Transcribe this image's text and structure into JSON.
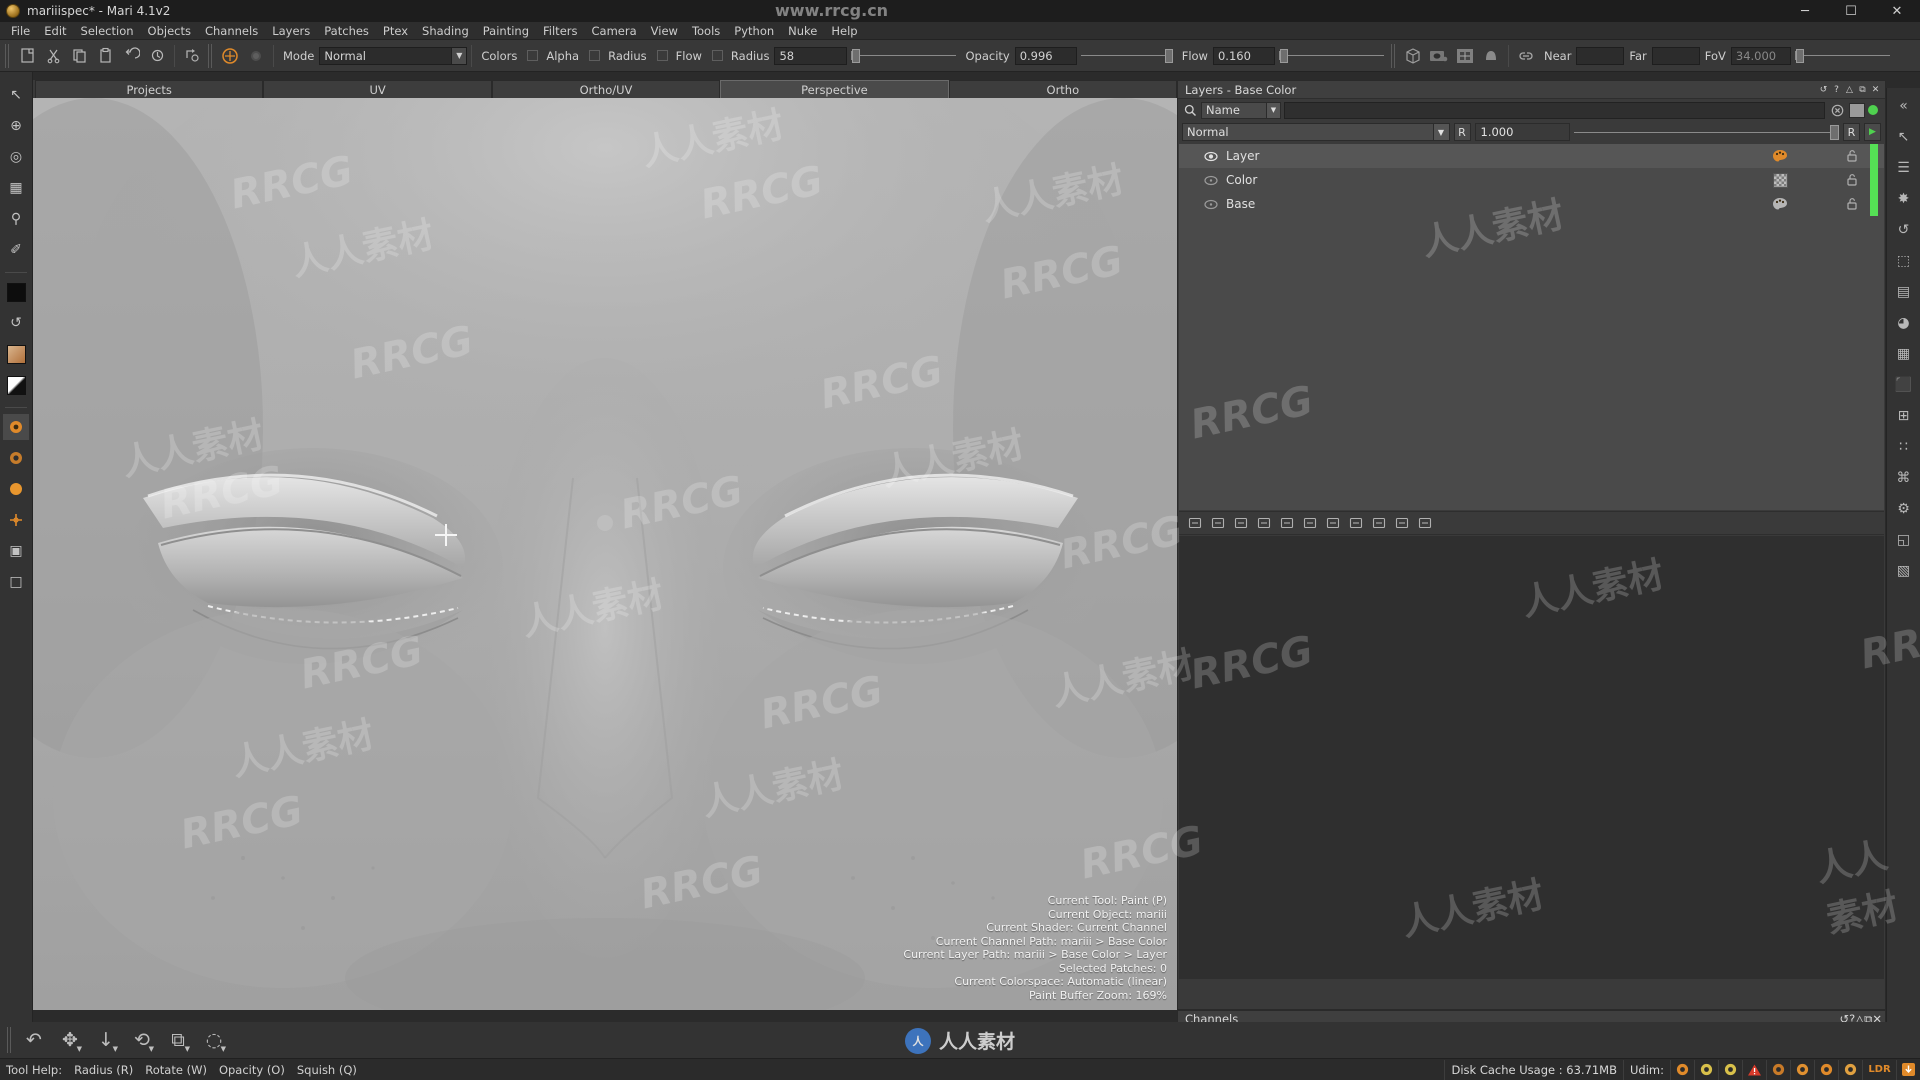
{
  "window": {
    "title": "mariiispec* - Mari 4.1v2",
    "app_icon": "mari-logo-icon",
    "controls": {
      "minimize": "─",
      "maximize": "☐",
      "close": "✕"
    }
  },
  "menubar": {
    "items": [
      "File",
      "Edit",
      "Selection",
      "Objects",
      "Channels",
      "Layers",
      "Patches",
      "Ptex",
      "Shading",
      "Painting",
      "Filters",
      "Camera",
      "View",
      "Tools",
      "Python",
      "Nuke",
      "Help"
    ]
  },
  "toolbar": {
    "mode_label": "Mode",
    "mode_value": "Normal",
    "colors_label": "Colors",
    "alpha_label": "Alpha",
    "radius_check_label": "Radius",
    "flow_check_label": "Flow",
    "radius_label": "Radius",
    "radius_value": "58",
    "opacity_label": "Opacity",
    "opacity_value": "0.996",
    "flow_label": "Flow",
    "flow_value": "0.160",
    "near_label": "Near",
    "near_value": "",
    "far_label": "Far",
    "far_value": "",
    "fov_label": "FoV",
    "fov_value": "34.000",
    "icons": [
      "new-project-icon",
      "cut-icon",
      "copy-icon",
      "paste-icon",
      "undo-history-icon",
      "redo-history-icon",
      "transform-icon",
      "paint-target-icon",
      "blur-brush-icon",
      "cube-view-icon",
      "camera-view-icon",
      "uv-grid-icon",
      "shader-ball-icon",
      "link-camera-icon"
    ]
  },
  "left_tools": {
    "items": [
      {
        "name": "select-arrow-tool",
        "glyph": "↖"
      },
      {
        "name": "paint-target-tool",
        "glyph": "⊕"
      },
      {
        "name": "magnifier-select-tool",
        "glyph": "◎"
      },
      {
        "name": "grid-marquee-tool",
        "glyph": "▦"
      },
      {
        "name": "zoom-tool",
        "glyph": "⚲"
      },
      {
        "name": "eyedropper-tool",
        "glyph": "✐"
      },
      {
        "name": "foreground-color-swatch",
        "glyph": ""
      },
      {
        "name": "swap-colors-tool",
        "glyph": "↺"
      },
      {
        "name": "gradient-swatch",
        "glyph": ""
      },
      {
        "name": "gradient-ramp-swatch",
        "glyph": ""
      },
      {
        "name": "paint-brush-tool",
        "glyph": "✎"
      },
      {
        "name": "blur-tool",
        "glyph": "◉"
      },
      {
        "name": "smudge-tool",
        "glyph": "⬤"
      },
      {
        "name": "clone-stamp-tool",
        "glyph": "✛"
      },
      {
        "name": "transform-selection-tool",
        "glyph": "▣"
      },
      {
        "name": "crop-tool",
        "glyph": "□"
      }
    ]
  },
  "right_rail": {
    "items": [
      {
        "name": "collapse-panel-icon",
        "glyph": "«"
      },
      {
        "name": "pin-panel-icon",
        "glyph": "↖"
      },
      {
        "name": "layers-palette-icon",
        "glyph": "☰"
      },
      {
        "name": "shading-palette-icon",
        "glyph": "✸"
      },
      {
        "name": "history-palette-icon",
        "glyph": "↺"
      },
      {
        "name": "projectors-palette-icon",
        "glyph": "⬚"
      },
      {
        "name": "image-manager-icon",
        "glyph": "▤"
      },
      {
        "name": "color-palette-icon",
        "glyph": "◕"
      },
      {
        "name": "shelf-palette-icon",
        "glyph": "▦"
      },
      {
        "name": "objects-palette-icon",
        "glyph": "⬛"
      },
      {
        "name": "uv-palette-icon",
        "glyph": "⊞"
      },
      {
        "name": "patches-palette-icon",
        "glyph": "∷"
      },
      {
        "name": "python-palette-icon",
        "glyph": "⌘"
      },
      {
        "name": "tool-properties-icon",
        "glyph": "⚙"
      },
      {
        "name": "snapshots-palette-icon",
        "glyph": "◱"
      },
      {
        "name": "channels-palette-icon",
        "glyph": "▧"
      }
    ]
  },
  "tabs": {
    "items": [
      {
        "label": "Projects",
        "active": false
      },
      {
        "label": "UV",
        "active": false
      },
      {
        "label": "Ortho/UV",
        "active": false
      },
      {
        "label": "Perspective",
        "active": true
      },
      {
        "label": "Ortho",
        "active": false
      }
    ]
  },
  "viewport": {
    "status_lines": [
      "Current Tool: Paint (P)",
      "Current Object: mariii",
      "Current Shader: Current Channel",
      "Current Channel Path: mariii > Base Color",
      "Current Layer Path: mariii > Base Color > Layer",
      "Selected Patches: 0",
      "Current Colorspace: Automatic (linear)",
      "Paint Buffer Zoom: 169%"
    ]
  },
  "layers_panel": {
    "title": "Layers - Base Color",
    "header_buttons": [
      {
        "name": "panel-refresh-icon",
        "glyph": "↺"
      },
      {
        "name": "panel-help-icon",
        "glyph": "?"
      },
      {
        "name": "panel-popout-icon",
        "glyph": "△"
      },
      {
        "name": "panel-restore-icon",
        "glyph": "⧉"
      },
      {
        "name": "panel-close-icon",
        "glyph": "✕"
      }
    ],
    "search": {
      "icon": "search-icon",
      "filter_value": "Name",
      "input_value": "",
      "clear_icon": "clear-search-icon",
      "mask_icon": "mask-toggle-icon",
      "status_dot_color": "#4fd14f"
    },
    "blend": {
      "mode_value": "Normal",
      "r_button_label": "R",
      "opacity_value": "1.000",
      "r_button2_label": "R",
      "play_icon": "play-icon"
    },
    "layers": [
      {
        "name": "Layer",
        "visible": true,
        "selected": true,
        "thumb": "paint-palette-icon",
        "locked": false
      },
      {
        "name": "Color",
        "visible": false,
        "selected": false,
        "thumb": "checker-fill-icon",
        "locked": false
      },
      {
        "name": "Base",
        "visible": false,
        "selected": false,
        "thumb": "paint-palette-icon",
        "locked": false
      }
    ],
    "layer_toolbar_icons": [
      "add-mask-icon",
      "add-adjustment-icon",
      "add-layer-icon",
      "add-group-icon",
      "add-procedural-icon",
      "duplicate-layer-icon",
      "merge-layer-icon",
      "share-layer-icon",
      "transfer-layer-icon",
      "layer-properties-icon",
      "grid-view-icon"
    ]
  },
  "channels_panel": {
    "title": "Channels",
    "header_buttons": [
      {
        "name": "panel-refresh-icon",
        "glyph": "↺"
      },
      {
        "name": "panel-help-icon",
        "glyph": "?"
      },
      {
        "name": "panel-popout-icon",
        "glyph": "△"
      },
      {
        "name": "panel-restore-icon",
        "glyph": "⧉"
      },
      {
        "name": "panel-close-icon",
        "glyph": "✕"
      }
    ]
  },
  "bottom_bar": {
    "icons": [
      {
        "name": "undo-icon",
        "glyph": "↶",
        "caret": false
      },
      {
        "name": "pan-tool-icon",
        "glyph": "✥",
        "caret": true
      },
      {
        "name": "dolly-tool-icon",
        "glyph": "↓",
        "caret": true
      },
      {
        "name": "rotate-tool-icon",
        "glyph": "⟲",
        "caret": true
      },
      {
        "name": "orbit-tool-icon",
        "glyph": "⧉",
        "caret": true
      },
      {
        "name": "brush-radius-icon",
        "glyph": "◌",
        "caret": true
      }
    ]
  },
  "status_bar": {
    "tool_help_label": "Tool Help:",
    "shortcuts": [
      "Radius (R)",
      "Rotate (W)",
      "Opacity (O)",
      "Squish (Q)"
    ],
    "disk_cache": "Disk Cache Usage : 63.71MB",
    "udim_label": "Udim:",
    "udim_value": "",
    "indicator_icons": [
      {
        "name": "gpu-status-icon",
        "color": "#e08a2a"
      },
      {
        "name": "texture-warning-icon",
        "color": "#d8c04a"
      },
      {
        "name": "patch-warning-icon",
        "color": "#d8c04a"
      },
      {
        "name": "error-alert-icon",
        "color": "#d83a2a"
      },
      {
        "name": "progress-ring-icon",
        "color": "#c87a28"
      },
      {
        "name": "bake-status-icon",
        "color": "#e09030"
      },
      {
        "name": "project-saved-icon",
        "color": "#e08a2a"
      },
      {
        "name": "cache-icon",
        "color": "#e0a040"
      },
      {
        "name": "ldr-mode-icon",
        "color": "#e08a2a"
      },
      {
        "name": "download-icon",
        "color": "#e08a2a"
      }
    ],
    "ldr_label": "LDR"
  },
  "watermarks": {
    "url": "www.rrcg.cn",
    "brand": "RRCG",
    "cn": "人人素材"
  },
  "colors": {
    "accent_orange": "#e08a2a",
    "green_strip": "#55e055",
    "panel_bg": "#3a3a3a",
    "viewport_bg": "#a9a9a9"
  }
}
